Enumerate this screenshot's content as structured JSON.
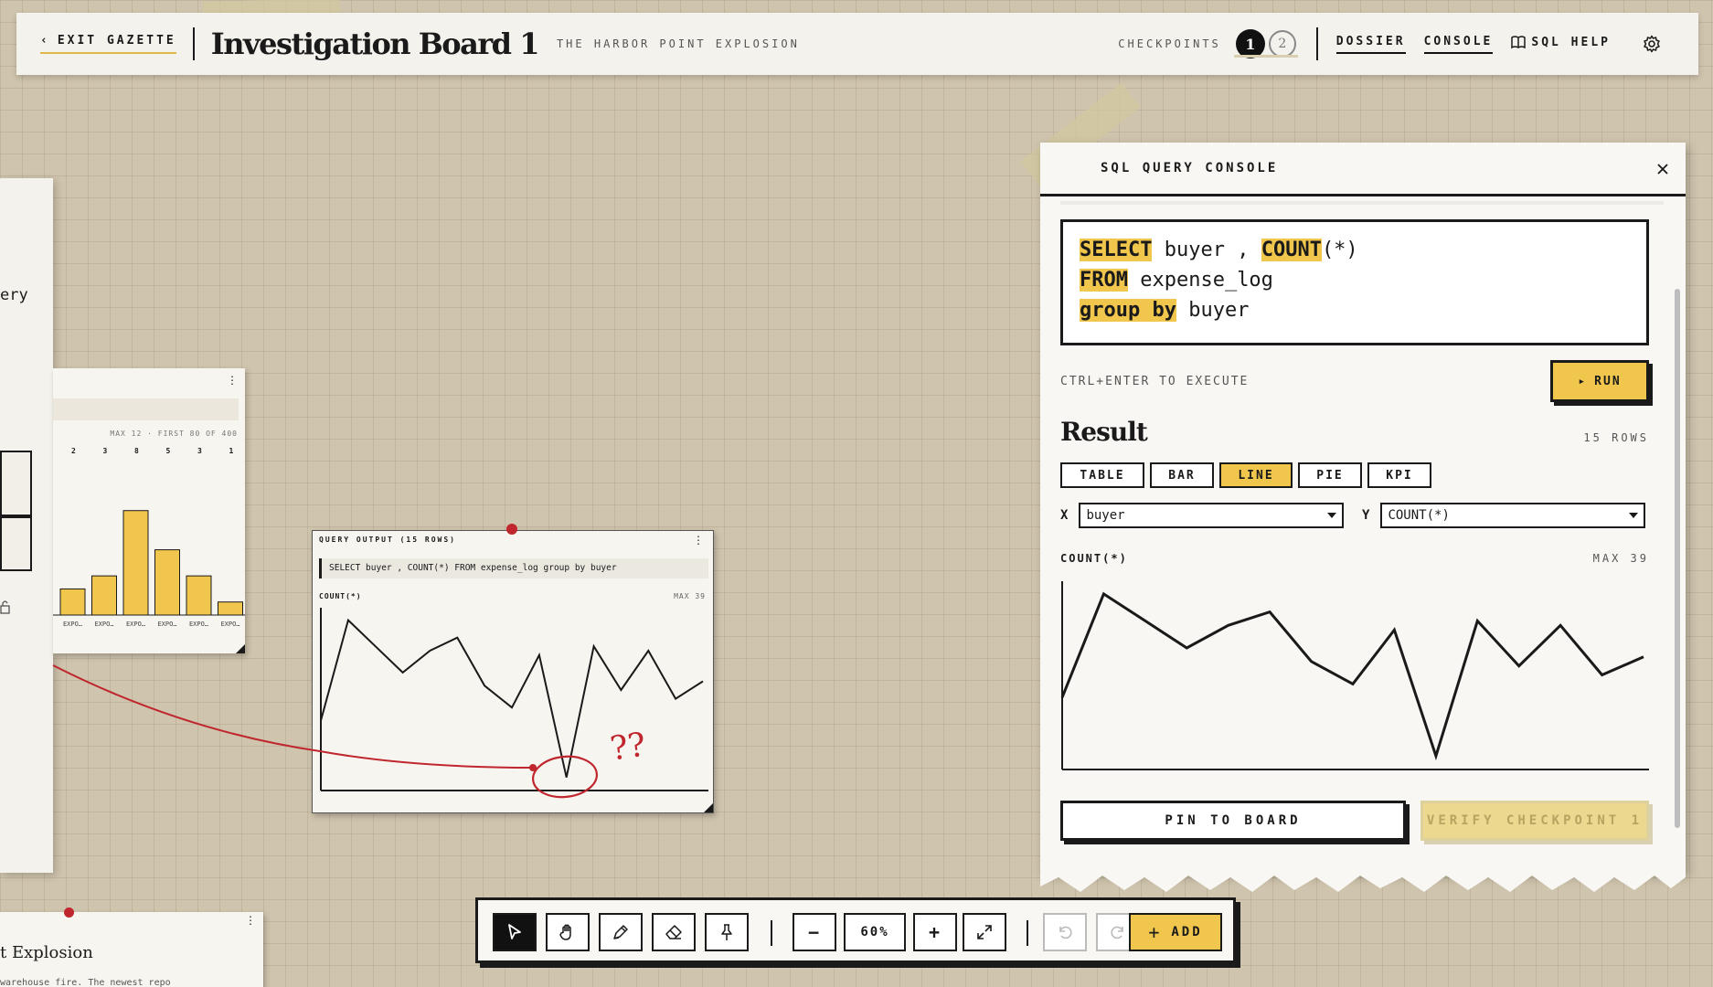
{
  "header": {
    "exit_label": "EXIT GAZETTE",
    "exit_chevron": "‹",
    "board_title": "Investigation Board 1",
    "case_subtitle": "THE HARBOR POINT EXPLOSION",
    "checkpoints_label": "CHECKPOINTS",
    "checkpoints": [
      "1",
      "2"
    ],
    "active_checkpoint": 1,
    "nav": {
      "dossier": "DOSSIER",
      "console": "CONSOLE",
      "sql_help": "SQL HELP"
    },
    "icons": [
      "book-icon",
      "gear-icon"
    ]
  },
  "board": {
    "left_paper_fragment": "ery",
    "bar_card": {
      "meta": "MAX 12 · FIRST 80 OF 400",
      "value_labels": [
        "2",
        "3",
        "8",
        "5",
        "3",
        "1"
      ],
      "category_labels": [
        "EXPO…",
        "EXPO…",
        "EXPO…",
        "EXPO…",
        "EXPO…",
        "EXPO…"
      ],
      "chart_data": {
        "type": "bar",
        "categories": [
          "EXPO…",
          "EXPO…",
          "EXPO…",
          "EXPO…",
          "EXPO…",
          "EXPO…"
        ],
        "values": [
          2,
          3,
          8,
          5,
          3,
          1
        ]
      },
      "bar_color": "#f1c64c"
    },
    "output_card": {
      "title": "QUERY OUTPUT (15 ROWS)",
      "sql": "SELECT buyer , COUNT(*) FROM expense_log group by buyer",
      "ylabel": "COUNT(*)",
      "max_label": "MAX 39",
      "annotation": "??"
    },
    "bottom_card": {
      "title": "t Explosion",
      "snippet": "warehouse fire. The newest repo"
    },
    "string_color": "#c0262e"
  },
  "console": {
    "title": "SQL QUERY CONSOLE",
    "query_lines": [
      [
        {
          "kw": "SELECT"
        },
        {
          "t": " buyer , "
        },
        {
          "kw": "COUNT"
        },
        {
          "t": "(*)"
        }
      ],
      [
        {
          "kw": "FROM"
        },
        {
          "t": " expense_log"
        }
      ],
      [
        {
          "kw": "group by"
        },
        {
          "t": " buyer"
        }
      ]
    ],
    "hint": "CTRL+ENTER TO EXECUTE",
    "run_label": "RUN",
    "run_icon": "▸",
    "result_title": "Result",
    "rows_label": "15 ROWS",
    "view_tabs": [
      "TABLE",
      "BAR",
      "LINE",
      "PIE",
      "KPI"
    ],
    "active_tab": "LINE",
    "x_axis_letter": "X",
    "x_field": "buyer",
    "y_axis_letter": "Y",
    "y_field": "COUNT(*)",
    "chart_ylabel": "COUNT(*)",
    "chart_max": "MAX 39",
    "pin_label": "PIN TO BOARD",
    "verify_label": "VERIFY CHECKPOINT 1",
    "accent": "#f1c64c"
  },
  "chart_data": {
    "type": "line",
    "x": [
      1,
      2,
      3,
      4,
      5,
      6,
      7,
      8,
      9,
      10,
      11,
      12,
      13,
      14,
      15
    ],
    "values": [
      16,
      39,
      33,
      27,
      32,
      35,
      24,
      19,
      31,
      3,
      33,
      23,
      32,
      21,
      25
    ],
    "ylim": [
      0,
      41
    ],
    "ylabel": "COUNT(*)",
    "xlabel": "",
    "grid": false
  },
  "toolbar": {
    "tools": [
      "select-tool",
      "pan-tool",
      "draw-tool",
      "eraser-tool",
      "pin-tool"
    ],
    "zoom_out": "−",
    "zoom_level": "60%",
    "zoom_in": "+",
    "add_label": "ADD",
    "add_icon": "+"
  }
}
